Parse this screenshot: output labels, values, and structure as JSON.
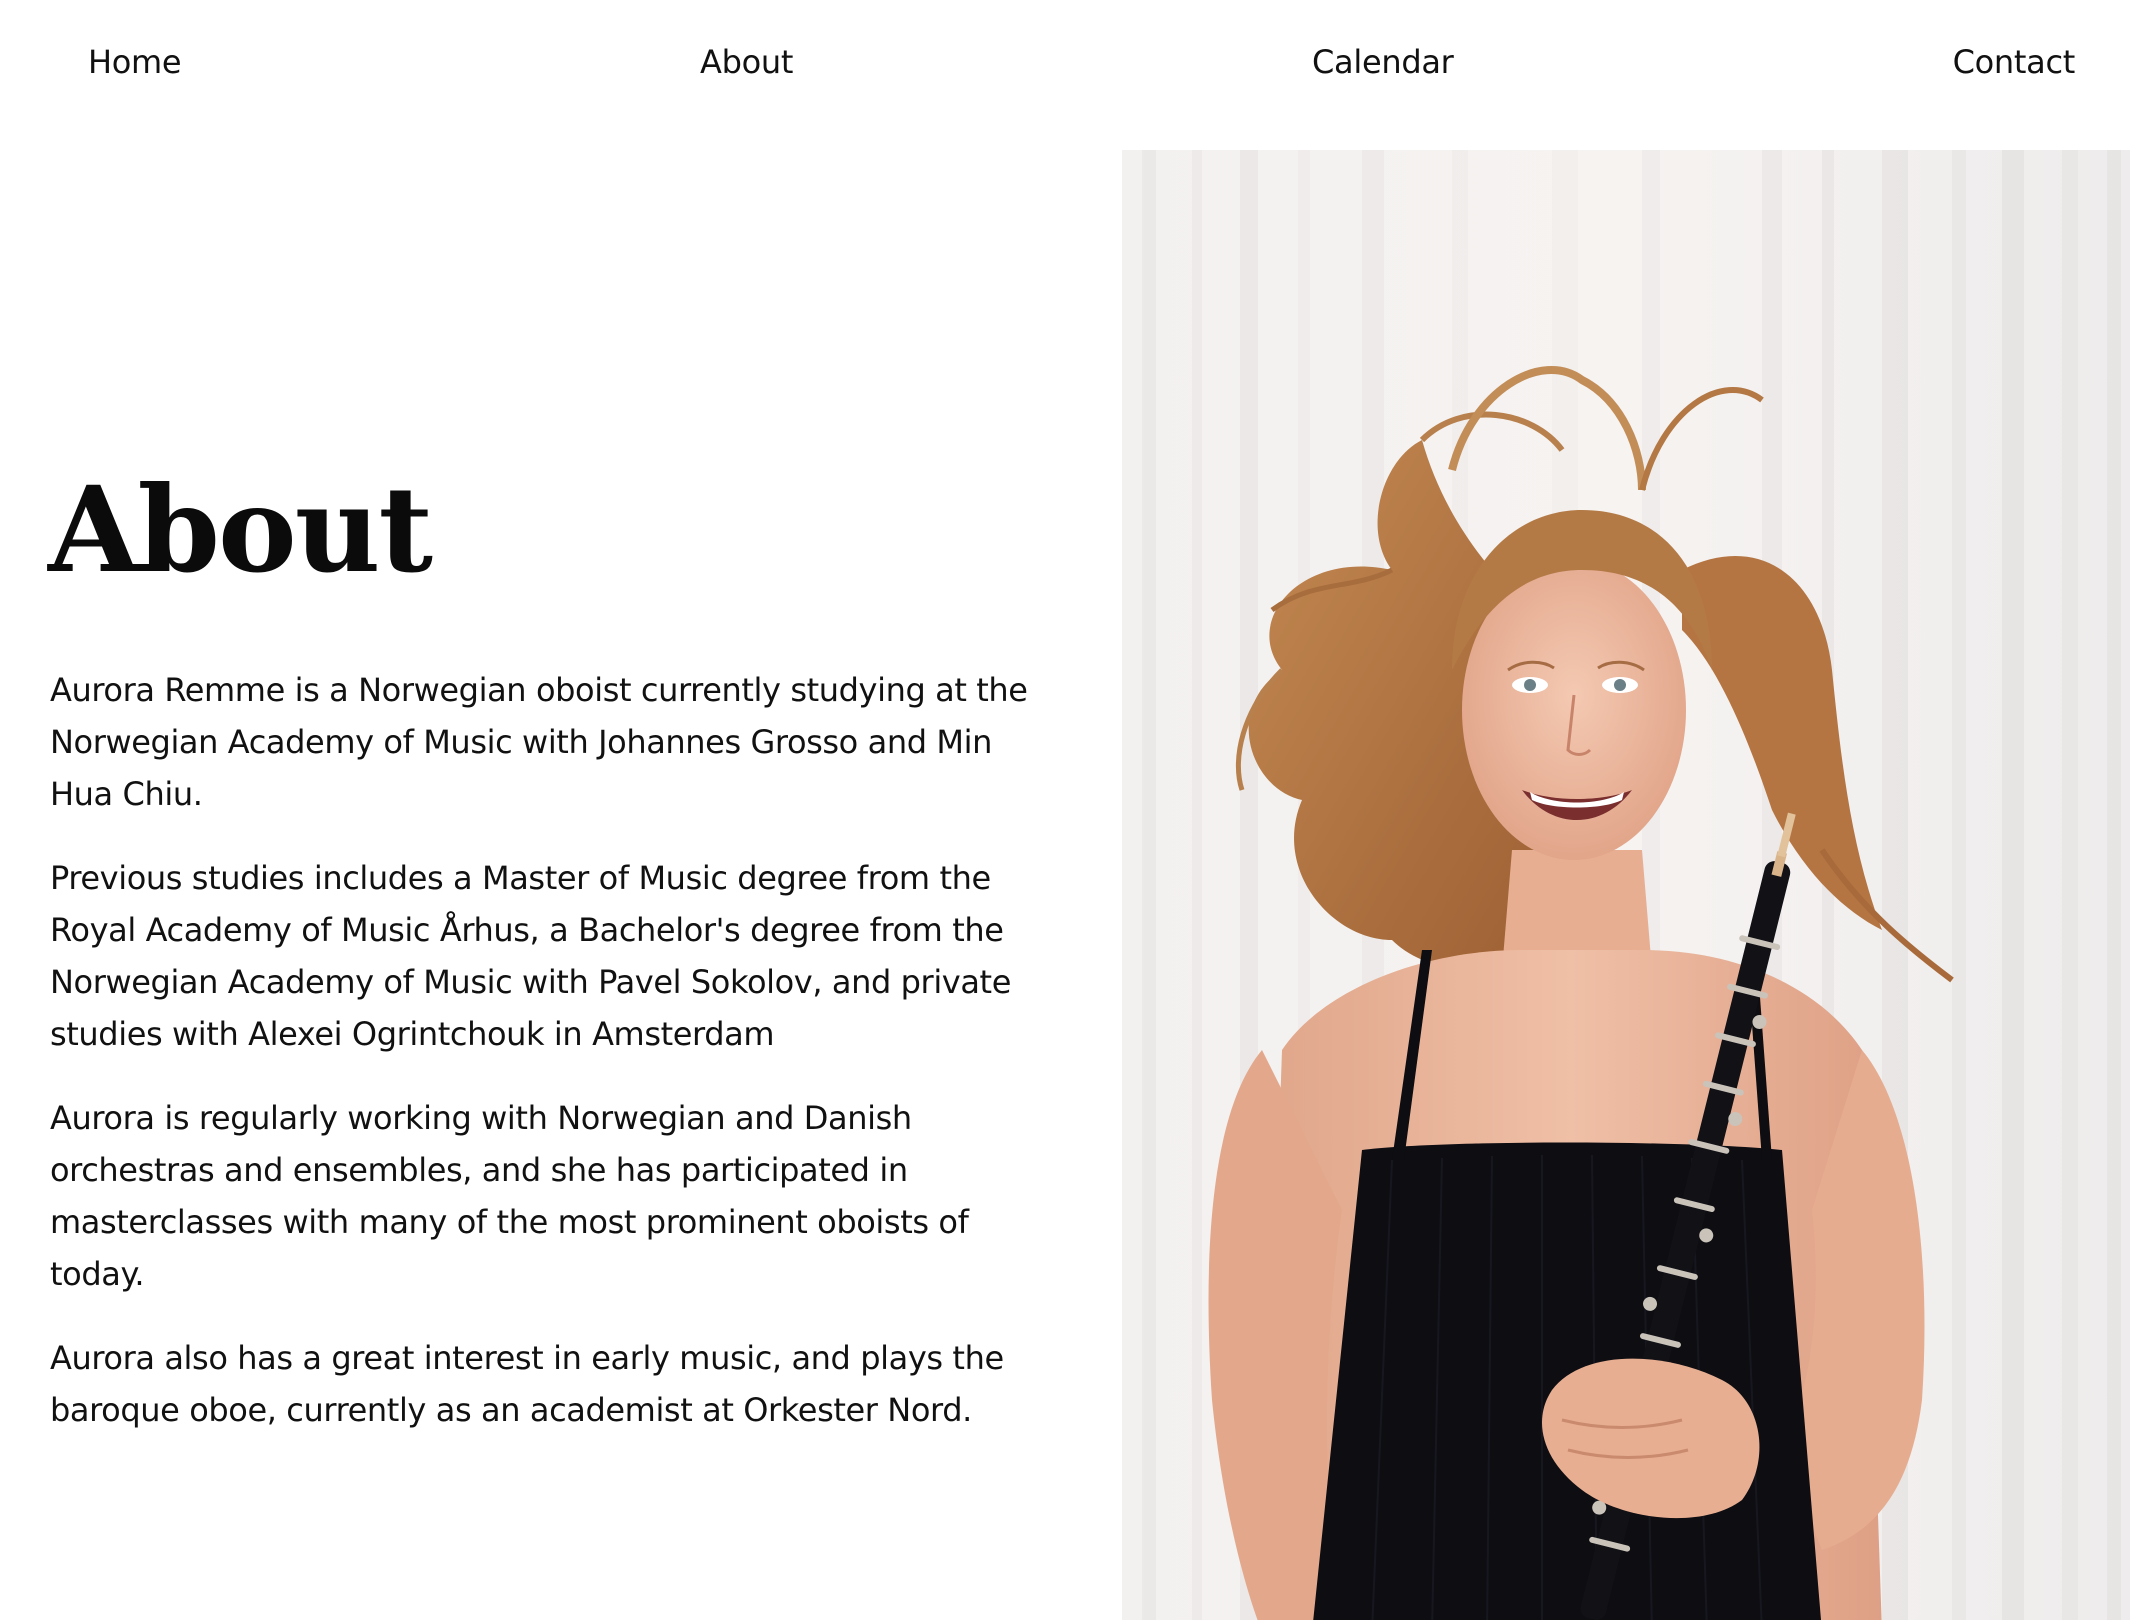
{
  "nav": {
    "home": "Home",
    "about": "About",
    "calendar": "Calendar",
    "contact": "Contact"
  },
  "page": {
    "title": "About"
  },
  "bio": {
    "p1": "Aurora Remme is a Norwegian oboist currently studying at the Norwegian Academy of Music with Johannes Grosso and Min Hua Chiu.",
    "p2": "Previous studies includes a Master of Music degree from the Royal Academy of Music Århus, a Bachelor's degree from the Norwegian Academy of Music with Pavel Sokolov, and private studies with Alexei Ogrintchouk in Amsterdam",
    "p3": "Aurora is regularly working with Norwegian and Danish orchestras and ensembles, and she has participated in masterclasses with many of the most prominent oboists of today.",
    "p4": "Aurora also has a great interest in early music, and plays the baroque oboe, currently as an academist at Orkester Nord."
  },
  "colors": {
    "background": "#ffffff",
    "text": "#111111",
    "curtain": "#f1efee",
    "dress": "#0d0d12",
    "hair": "#b87a45",
    "skin": "#e9b397"
  }
}
